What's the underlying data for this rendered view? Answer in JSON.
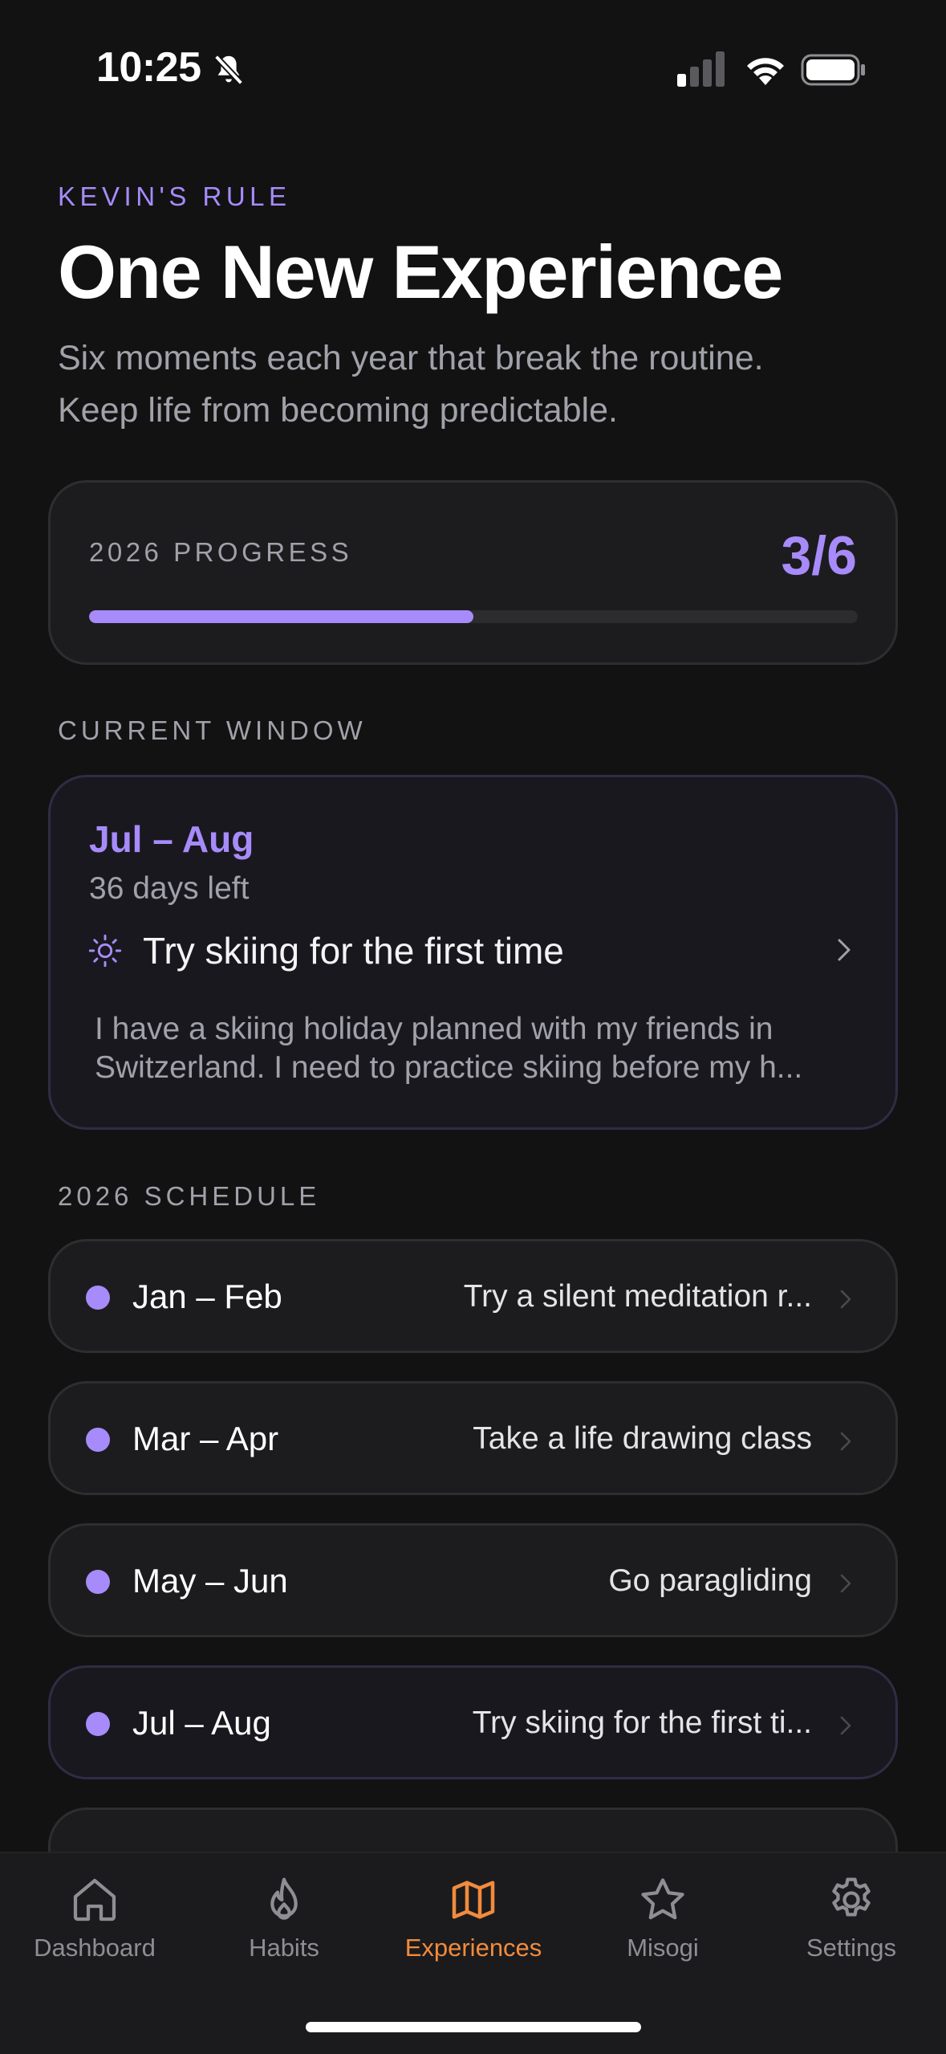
{
  "status_bar": {
    "time": "10:25"
  },
  "header": {
    "eyebrow": "KEVIN'S RULE",
    "title": "One New Experience",
    "subtitle_line1": "Six moments each year that break the routine.",
    "subtitle_line2": "Keep life from becoming predictable."
  },
  "progress": {
    "label": "2026 PROGRESS",
    "count": "3/6",
    "completed": 3,
    "total": 6
  },
  "current_window": {
    "section_label": "CURRENT WINDOW",
    "range": "Jul – Aug",
    "days_left": "36 days left",
    "title": "Try skiing for the first time",
    "note_line1": "I have a skiing holiday planned with my friends in",
    "note_line2": "Switzerland. I need to practice skiing before my h..."
  },
  "schedule": {
    "section_label": "2026 SCHEDULE",
    "rows": [
      {
        "range": "Jan – Feb",
        "goal": "Try a silent meditation r..."
      },
      {
        "range": "Mar – Apr",
        "goal": "Take a life drawing class"
      },
      {
        "range": "May – Jun",
        "goal": "Go paragliding"
      },
      {
        "range": "Jul – Aug",
        "goal": "Try skiing for the first ti..."
      }
    ]
  },
  "tabbar": {
    "tabs": [
      {
        "label": "Dashboard",
        "icon": "home-icon"
      },
      {
        "label": "Habits",
        "icon": "flame-icon"
      },
      {
        "label": "Experiences",
        "icon": "map-icon",
        "active": true
      },
      {
        "label": "Misogi",
        "icon": "star-icon"
      },
      {
        "label": "Settings",
        "icon": "gear-icon"
      }
    ]
  },
  "colors": {
    "accent": "#a78bfa",
    "tab_active": "#f28b3c",
    "background": "#121213"
  }
}
